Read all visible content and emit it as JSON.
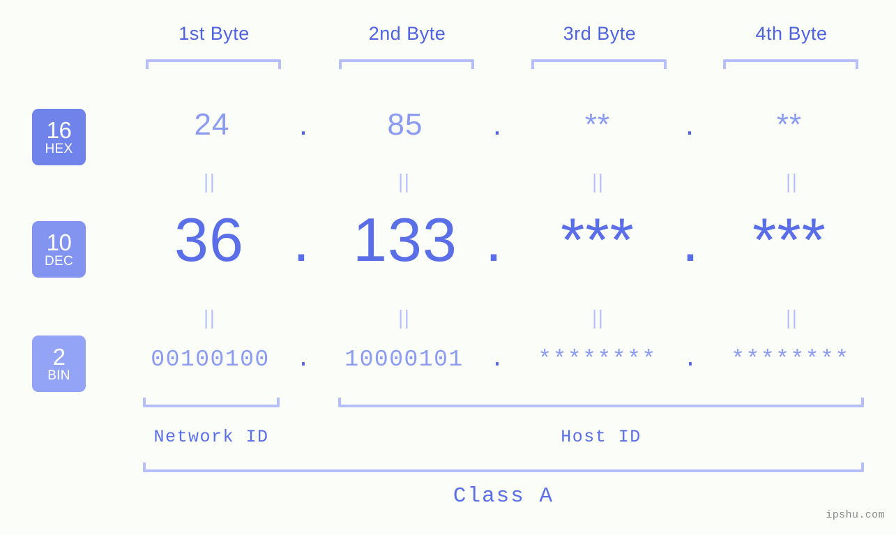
{
  "header": {
    "byte_labels": [
      "1st Byte",
      "2nd Byte",
      "3rd Byte",
      "4th Byte"
    ]
  },
  "bases": [
    {
      "num": "16",
      "name": "HEX",
      "color": "#7083ea"
    },
    {
      "num": "10",
      "name": "DEC",
      "color": "#8294f0"
    },
    {
      "num": "2",
      "name": "BIN",
      "color": "#93a4f6"
    }
  ],
  "separators": {
    "equals": "||",
    "dot": "."
  },
  "rows": {
    "hex": {
      "values": [
        "24",
        "85",
        "**",
        "**"
      ]
    },
    "dec": {
      "values": [
        "36",
        "133",
        "***",
        "***"
      ]
    },
    "bin": {
      "values": [
        "00100100",
        "10000101",
        "********",
        "********"
      ]
    }
  },
  "sections": {
    "network_id": "Network ID",
    "host_id": "Host ID",
    "class": "Class A"
  },
  "footer": {
    "watermark": "ipshu.com"
  },
  "colors": {
    "background": "#fbfdf8",
    "bracket": "#b6bffa",
    "accent_strong": "#4f63e0",
    "accent_mid": "#5a6ee8",
    "accent_light": "#8b9bf2"
  }
}
